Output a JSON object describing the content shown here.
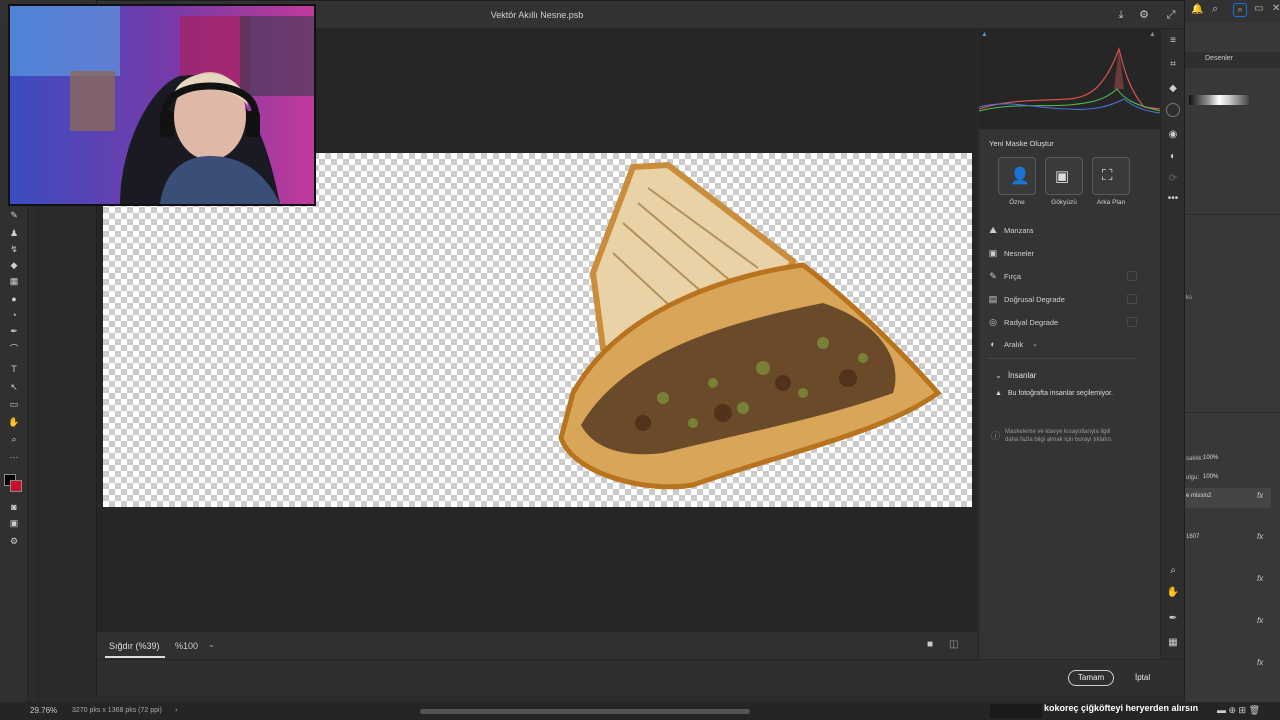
{
  "dialog": {
    "title": "Vektör Akıllı Nesne.psb",
    "zoom_fit": "Sığdır (%39)",
    "zoom_percent": "%100",
    "ok_label": "Tamam",
    "cancel_label": "İptal"
  },
  "mask_panel": {
    "header": "Yeni Maske Oluştur",
    "presets": [
      {
        "label": "Özne",
        "icon": "person-icon"
      },
      {
        "label": "Gökyüzü",
        "icon": "sky-icon"
      },
      {
        "label": "Arka Plan",
        "icon": "background-icon"
      }
    ],
    "items": [
      {
        "label": "Manzara",
        "icon": "landscape-icon"
      },
      {
        "label": "Nesneler",
        "icon": "objects-icon"
      },
      {
        "label": "Fırça",
        "icon": "brush-icon"
      },
      {
        "label": "Doğrusal Degrade",
        "icon": "linear-gradient-icon"
      },
      {
        "label": "Radyal Degrade",
        "icon": "radial-gradient-icon"
      },
      {
        "label": "Aralık",
        "icon": "range-icon"
      }
    ],
    "people_section": "İnsanlar",
    "people_warning": "Bu fotoğrafta insanlar seçilemiyor.",
    "help_text_1": "Maskeleme ve klavye kısayollarıyla ilgili",
    "help_text_2": "daha fazla bilgi almak için burayı tıklatın."
  },
  "ps_right": {
    "tab": "Desenler",
    "opacity_label": "saklık:",
    "opacity_value": "100%",
    "fill_label": "olgu:",
    "fill_value": "100%",
    "layer1": "e missin2",
    "layer2": "1607",
    "ks": "ks"
  },
  "status": {
    "zoom": "29.76%",
    "doc_info": "3270 pks x 1368 pks (72 ppi)"
  },
  "marquee_text": "kokoreç çiğköfteyi heryerden alırsın",
  "colors": {
    "accent": "#1473e6",
    "bg": "#2b2b2b",
    "panel": "#343434"
  }
}
